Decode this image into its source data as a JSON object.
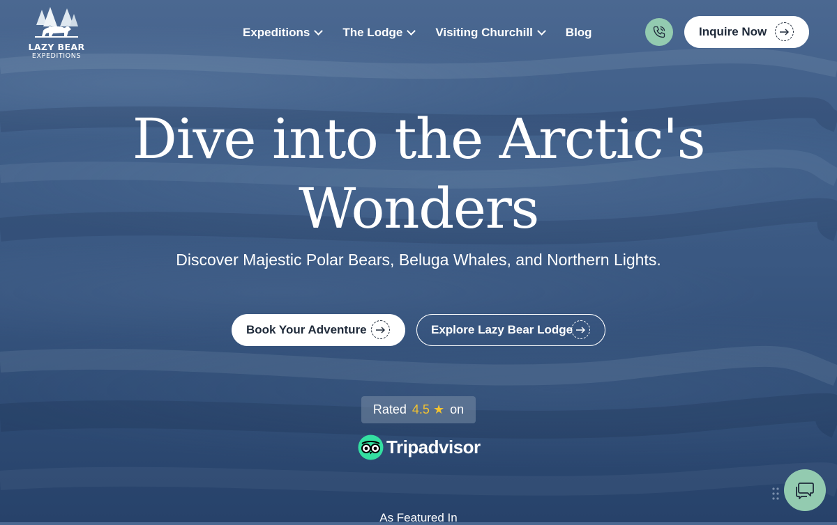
{
  "brand": {
    "line1": "LAZY BEAR",
    "line2": "EXPEDITIONS"
  },
  "nav": {
    "items": [
      {
        "label": "Expeditions",
        "has_dropdown": true
      },
      {
        "label": "The Lodge",
        "has_dropdown": true
      },
      {
        "label": "Visiting Churchill",
        "has_dropdown": true
      },
      {
        "label": "Blog",
        "has_dropdown": false
      }
    ],
    "phone_icon": "phone-icon",
    "inquire_label": "Inquire Now"
  },
  "hero": {
    "headline_line1": "Dive into the Arctic's",
    "headline_line2": "Wonders",
    "subhead": "Discover Majestic Polar Bears, Beluga Whales, and Northern Lights.",
    "book_label": "Book Your Adventure",
    "explore_label": "Explore Lazy Bear Lodge"
  },
  "rating": {
    "prefix": "Rated",
    "value": "4.5",
    "suffix": "on",
    "platform": "Tripadvisor"
  },
  "featured": {
    "label": "As Featured In"
  },
  "colors": {
    "accent_green": "#93cbb0",
    "rating_gold": "#f2c230",
    "background_blue": "#3a5882",
    "button_text": "#1f2a3a"
  }
}
